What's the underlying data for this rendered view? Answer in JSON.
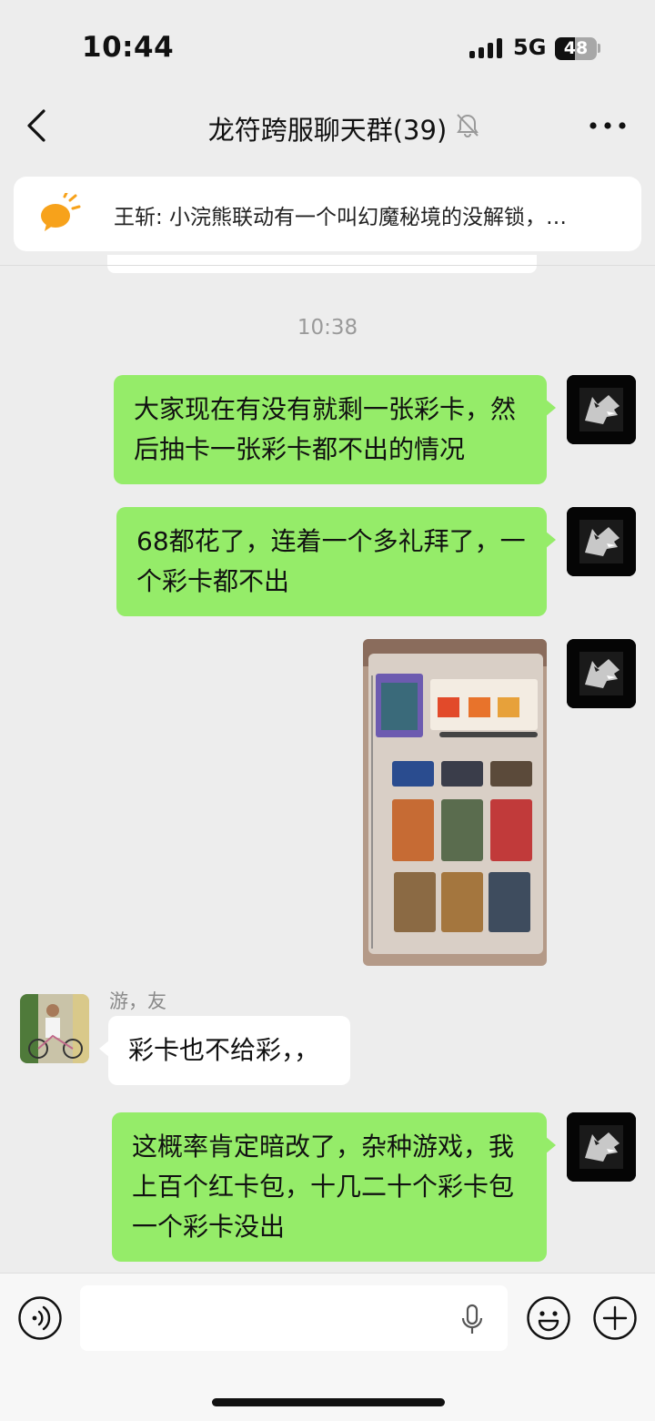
{
  "status_bar": {
    "time": "10:44",
    "network": "5G",
    "battery": "48",
    "battery_level": 0.48
  },
  "nav": {
    "title": "龙符跨服聊天群(39)",
    "back_icon": "chevron-left-icon",
    "mute_icon": "bell-muted-icon",
    "more_icon": "more-horizontal-icon"
  },
  "pinned": {
    "icon": "announcement-icon",
    "text": "王斩: 小浣熊联动有一个叫幻魔秘境的没解锁，…"
  },
  "chat": {
    "timestamp": "10:38",
    "messages": [
      {
        "direction": "out",
        "type": "text",
        "text": "大家现在有没有就剩一张彩卡，然后抽卡一张彩卡都不出的情况"
      },
      {
        "direction": "out",
        "type": "text",
        "text": "68都花了，连着一个多礼拜了，一个彩卡都不出"
      },
      {
        "direction": "out",
        "type": "image"
      },
      {
        "direction": "in",
        "type": "text",
        "sender": "游，友",
        "text": "彩卡也不给彩，，"
      },
      {
        "direction": "out",
        "type": "text",
        "text": "这概率肯定暗改了，杂种游戏，我上百个红卡包，十几二十个彩卡包一个彩卡没出"
      }
    ]
  },
  "input_bar": {
    "voice_icon": "voice-input-icon",
    "mic_icon": "microphone-icon",
    "emoji_icon": "emoji-icon",
    "plus_icon": "plus-icon"
  },
  "colors": {
    "outgoing_bubble": "#95ec69",
    "incoming_bubble": "#ffffff",
    "background": "#ededed"
  }
}
